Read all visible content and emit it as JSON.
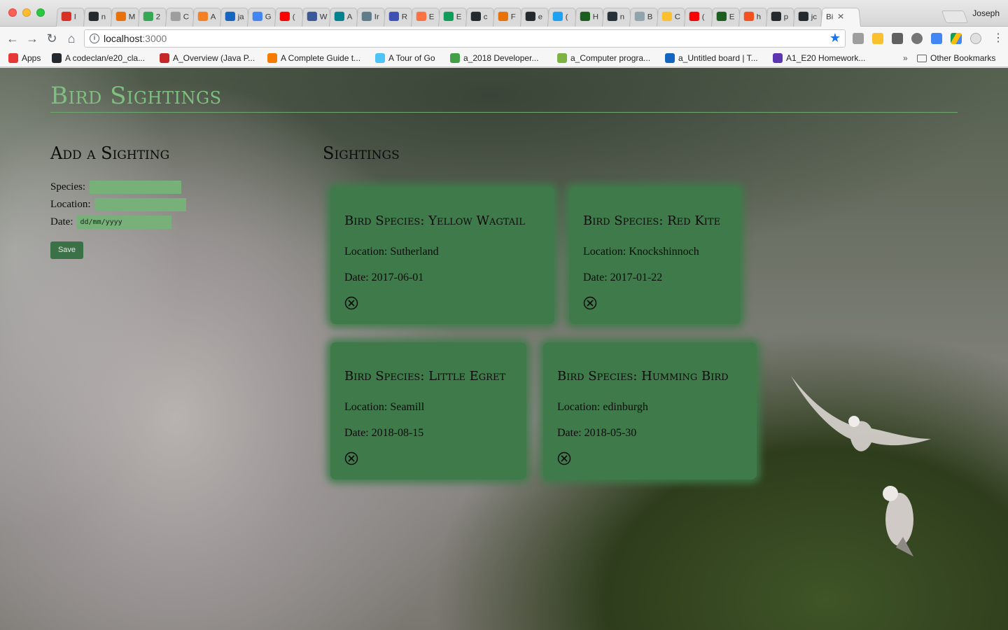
{
  "browser": {
    "tabs": [
      {
        "letter": "I",
        "color": "#d93025"
      },
      {
        "letter": "n",
        "color": "#24292e"
      },
      {
        "letter": "M",
        "color": "#e8710a"
      },
      {
        "letter": "2",
        "color": "#34a853"
      },
      {
        "letter": "C",
        "color": "#9e9e9e"
      },
      {
        "letter": "A",
        "color": "#f48024"
      },
      {
        "letter": "ja",
        "color": "#1565c0"
      },
      {
        "letter": "G",
        "color": "#4285f4"
      },
      {
        "letter": "(",
        "color": "#ff0000"
      },
      {
        "letter": "W",
        "color": "#3b5998"
      },
      {
        "letter": "A",
        "color": "#00838f"
      },
      {
        "letter": "Ir",
        "color": "#607d8b"
      },
      {
        "letter": "R",
        "color": "#3f51b5"
      },
      {
        "letter": "E",
        "color": "#ff7043"
      },
      {
        "letter": "E",
        "color": "#0f9d58"
      },
      {
        "letter": "c",
        "color": "#24292e"
      },
      {
        "letter": "F",
        "color": "#e8710a"
      },
      {
        "letter": "e",
        "color": "#24292e"
      },
      {
        "letter": "(",
        "color": "#1da1f2"
      },
      {
        "letter": "H",
        "color": "#1b5e20"
      },
      {
        "letter": "n",
        "color": "#263238"
      },
      {
        "letter": "B",
        "color": "#90a4ae"
      },
      {
        "letter": "C",
        "color": "#fbc02d"
      },
      {
        "letter": "(",
        "color": "#ff0000"
      },
      {
        "letter": "E",
        "color": "#1b5e20"
      },
      {
        "letter": "h",
        "color": "#f4511e"
      },
      {
        "letter": "p",
        "color": "#24292e"
      },
      {
        "letter": "jc",
        "color": "#24292e"
      }
    ],
    "active_tab": {
      "letter": "Bi",
      "close": "✕"
    },
    "profile": "Joseph",
    "url_host": "localhost",
    "url_port": ":3000",
    "bookmarks": [
      {
        "label": "Apps",
        "color": "#e53935"
      },
      {
        "label": "A codeclan/e20_cla...",
        "color": "#24292e"
      },
      {
        "label": "A_Overview (Java P...",
        "color": "#c62828"
      },
      {
        "label": "A Complete Guide t...",
        "color": "#f57c00"
      },
      {
        "label": "A Tour of Go",
        "color": "#4fc3f7"
      },
      {
        "label": "a_2018 Developer...",
        "color": "#43a047"
      },
      {
        "label": "a_Computer progra...",
        "color": "#7cb342"
      },
      {
        "label": "a_Untitled board | T...",
        "color": "#1565c0"
      },
      {
        "label": "A1_E20 Homework...",
        "color": "#5e35b1"
      }
    ],
    "bookmarks_overflow": "»",
    "other_bookmarks": "Other Bookmarks"
  },
  "page": {
    "title": "Bird Sightings",
    "form": {
      "heading": "Add a Sighting",
      "species_label": "Species:",
      "location_label": "Location:",
      "date_label": "Date:",
      "date_placeholder": "dd/mm/yyyy",
      "save_label": "Save"
    },
    "sightings_heading": "Sightings",
    "sightings": [
      {
        "species": "Bird Species: Yellow Wagtail",
        "location": "Location: Sutherland",
        "date": "Date: 2017-06-01"
      },
      {
        "species": "Bird Species: Red Kite",
        "location": "Location: Knockshinnoch",
        "date": "Date: 2017-01-22"
      },
      {
        "species": "Bird Species: Little Egret",
        "location": "Location: Seamill",
        "date": "Date: 2018-08-15"
      },
      {
        "species": "Bird Species: Humming Bird",
        "location": "Location: edinburgh",
        "date": "Date: 2018-05-30"
      }
    ]
  },
  "colors": {
    "title_green": "#7fbf7f",
    "card_green": "#3f7a4a",
    "input_green": "#78b07a",
    "button_green": "#3a7147"
  }
}
